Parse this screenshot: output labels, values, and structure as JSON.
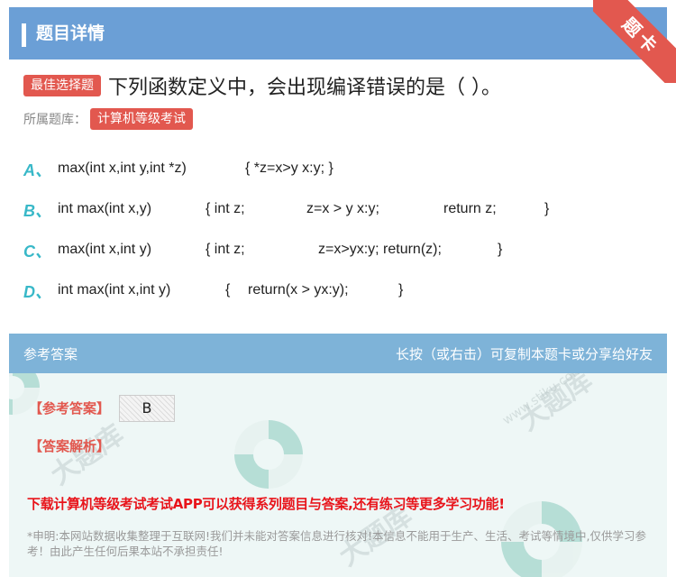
{
  "header": {
    "title": "题目详情",
    "corner_badge": "题卡"
  },
  "question": {
    "type_tag": "最佳选择题",
    "text": "下列函数定义中，会出现编译错误的是（   ）。",
    "library_label": "所属题库：",
    "library_tag": "计算机等级考试"
  },
  "options": [
    {
      "letter": "A、",
      "parts": [
        "max(int x,int y,int *z)",
        "{ *z=x>y x:y; }"
      ]
    },
    {
      "letter": "B、",
      "parts": [
        "int max(int x,y)",
        "{ int z;",
        "z=x > y x:y;",
        "return z;",
        "}"
      ]
    },
    {
      "letter": "C、",
      "parts": [
        "max(int x,int y)",
        "{ int z;",
        "z=x>yx:y; return(z);",
        "}"
      ]
    },
    {
      "letter": "D、",
      "parts": [
        "int max(int x,int y)",
        "{",
        "return(x > yx:y);",
        "}"
      ]
    }
  ],
  "answer": {
    "head_left": "参考答案",
    "head_right": "长按（或右击）可复制本题卡或分享给好友",
    "ref_label": "【参考答案】",
    "ref_value": "B",
    "analysis_label": "【答案解析】",
    "promo": "下载计算机等级考试考试APP可以获得系列题目与答案,还有练习等更多学习功能!",
    "disclaimer": "*申明:本网站数据收集整理于互联网!我们并未能对答案信息进行核对!本信息不能用于生产、生活、考试等情境中,仅供学习参考！由此产生任何后果本站不承担责任!"
  },
  "colors": {
    "header_blue": "#6b9fd6",
    "accent_red": "#e2584f",
    "option_teal": "#38b8c8",
    "promo_red": "#e8141b"
  }
}
